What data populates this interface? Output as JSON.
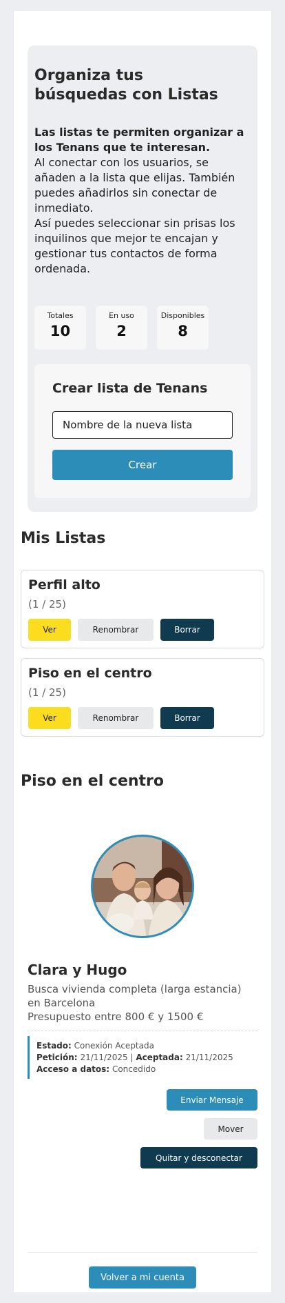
{
  "intro": {
    "title": "Organiza tus búsquedas con Listas",
    "bold_text": "Las listas te permiten organizar a los Tenans que te interesan.",
    "text_1": "Al conectar con los usuarios, se añaden a la lista que elijas. También puedes añadirlos sin conectar de inmediato.",
    "text_2": "Así puedes seleccionar sin prisas los inquilinos que mejor te encajan y gestionar tus contactos de forma ordenada."
  },
  "stats": [
    {
      "label": "Totales",
      "value": "10"
    },
    {
      "label": "En uso",
      "value": "2"
    },
    {
      "label": "Disponibles",
      "value": "8"
    }
  ],
  "create": {
    "title": "Crear lista de Tenans",
    "placeholder": "Nombre de la nueva lista",
    "button": "Crear"
  },
  "my_lists": {
    "title": "Mis Listas",
    "items": [
      {
        "name": "Perfil alto",
        "count": "(1 / 25)",
        "view": "Ver",
        "rename": "Renombrar",
        "delete": "Borrar"
      },
      {
        "name": "Piso en el centro",
        "count": "(1 / 25)",
        "view": "Ver",
        "rename": "Renombrar",
        "delete": "Borrar"
      }
    ]
  },
  "selected_list": {
    "title": "Piso en el centro",
    "tenant": {
      "name": "Clara y Hugo",
      "desc_1": "Busca vivienda completa (larga estancia) en Barcelona",
      "desc_2": "Presupuesto entre 800 € y 1500 €",
      "estado_label": "Estado:",
      "estado": "Conexión Aceptada",
      "peticion_label": "Petición:",
      "peticion": "21/11/2025",
      "separator": "|",
      "aceptada_label": "Aceptada:",
      "aceptada": "21/11/2025",
      "acceso_label": "Acceso a datos:",
      "acceso": "Concedido"
    },
    "actions": {
      "message": "Enviar Mensaje",
      "move": "Mover",
      "remove": "Quitar y desconectar"
    }
  },
  "footer": {
    "back": "Volver a mi cuenta"
  },
  "colors": {
    "accent": "#2b8db8",
    "dark": "#0f3a50",
    "yellow": "#fcdc1f",
    "panel": "#eceef1"
  }
}
